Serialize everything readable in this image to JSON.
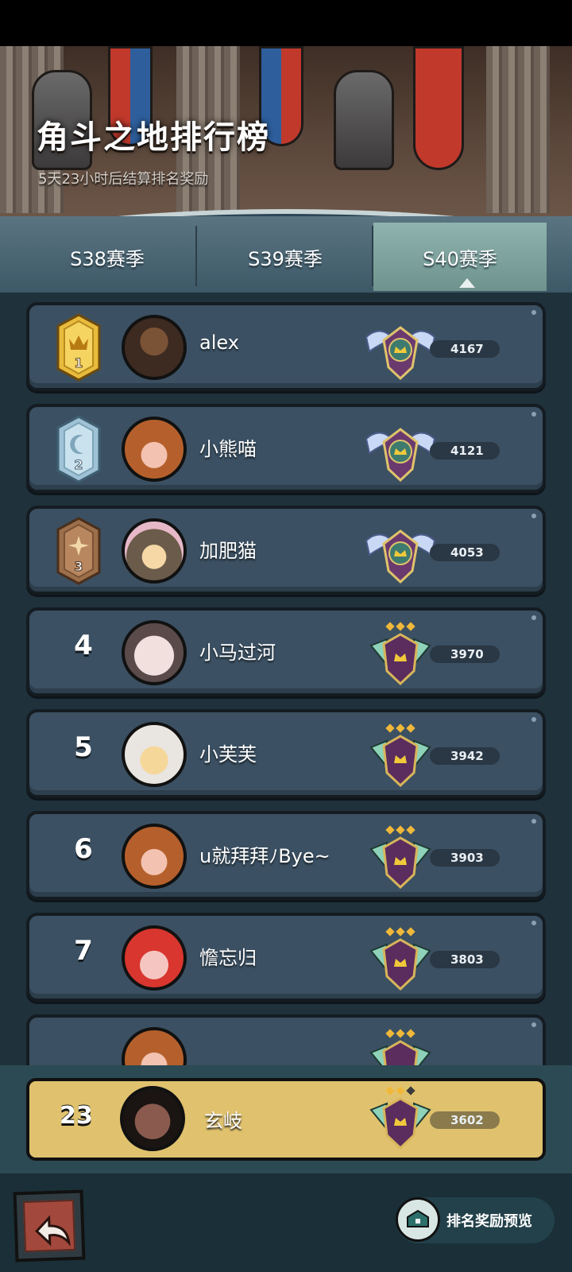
{
  "banner": {
    "title": "角斗之地排行榜",
    "subtitle": "5天23小时后结算排名奖励"
  },
  "tabs": [
    {
      "label": "S38赛季",
      "active": false
    },
    {
      "label": "S39赛季",
      "active": false
    },
    {
      "label": "S40赛季",
      "active": true
    }
  ],
  "rankings": [
    {
      "rank": "1",
      "name": "alex",
      "score": "4167",
      "tier": "winged"
    },
    {
      "rank": "2",
      "name": "小熊喵",
      "score": "4121",
      "tier": "winged"
    },
    {
      "rank": "3",
      "name": "加肥猫",
      "score": "4053",
      "tier": "winged"
    },
    {
      "rank": "4",
      "name": "小马过河",
      "score": "3970",
      "tier": "crest"
    },
    {
      "rank": "5",
      "name": "小芙芙",
      "score": "3942",
      "tier": "crest"
    },
    {
      "rank": "6",
      "name": "u就拜拜ﾉBye~",
      "score": "3903",
      "tier": "crest"
    },
    {
      "rank": "7",
      "name": "憺忘归",
      "score": "3803",
      "tier": "crest"
    }
  ],
  "self": {
    "rank": "23",
    "name": "玄岐",
    "score": "3602"
  },
  "footer": {
    "reward_label": "排名奖励预览"
  },
  "colors": {
    "gold_row": "#e0c26e",
    "row_bg": "#3b5062",
    "active_tab": "#8fb3ae"
  }
}
